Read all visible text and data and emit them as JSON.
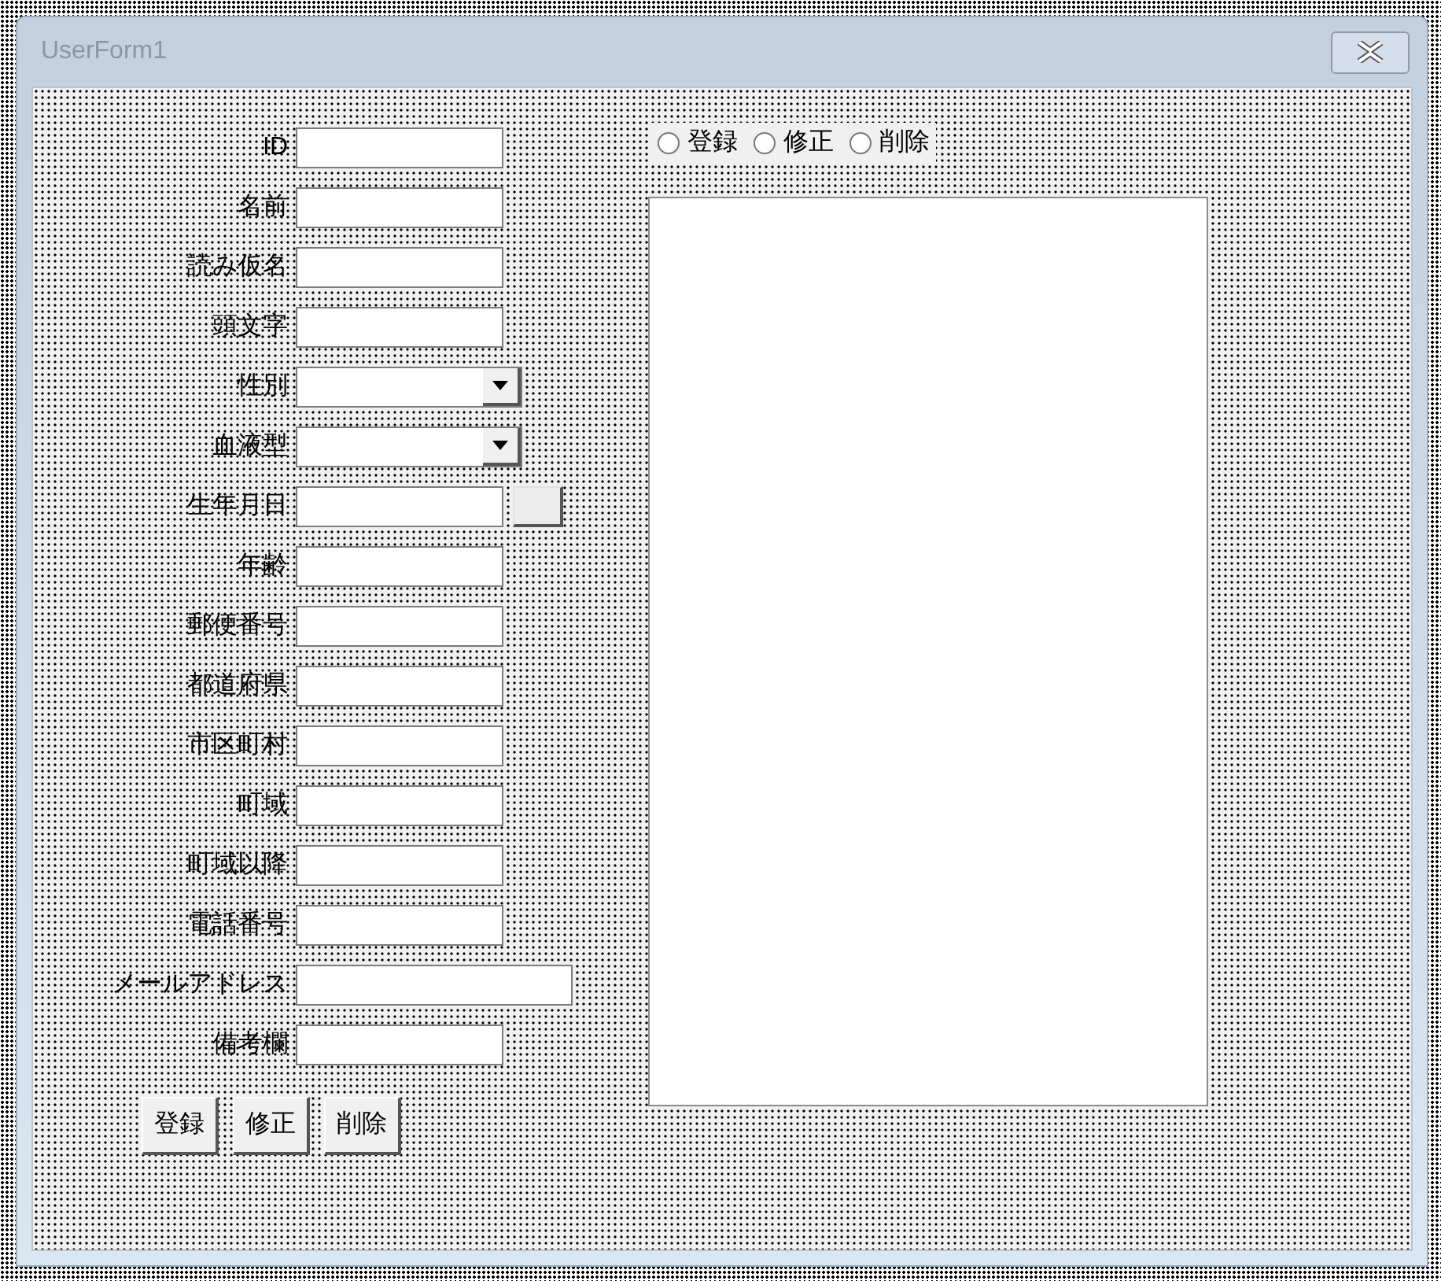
{
  "window": {
    "title": "UserForm1"
  },
  "fields": [
    {
      "label": "ID",
      "kind": "text"
    },
    {
      "label": "名前",
      "kind": "text"
    },
    {
      "label": "読み仮名",
      "kind": "text"
    },
    {
      "label": "頭文字",
      "kind": "text"
    },
    {
      "label": "性別",
      "kind": "combo"
    },
    {
      "label": "血液型",
      "kind": "combo"
    },
    {
      "label": "生年月日",
      "kind": "date"
    },
    {
      "label": "年齢",
      "kind": "text"
    },
    {
      "label": "郵便番号",
      "kind": "text"
    },
    {
      "label": "都道府県",
      "kind": "text"
    },
    {
      "label": "市区町村",
      "kind": "text"
    },
    {
      "label": "町域",
      "kind": "text"
    },
    {
      "label": "町域以降",
      "kind": "text"
    },
    {
      "label": "電話番号",
      "kind": "text"
    },
    {
      "label": "メールアドレス",
      "kind": "wide"
    },
    {
      "label": "備考欄",
      "kind": "text"
    }
  ],
  "mode_options": [
    {
      "label": "登録",
      "selected": false
    },
    {
      "label": "修正",
      "selected": false
    },
    {
      "label": "削除",
      "selected": false
    }
  ],
  "buttons": [
    "登録",
    "修正",
    "削除"
  ]
}
